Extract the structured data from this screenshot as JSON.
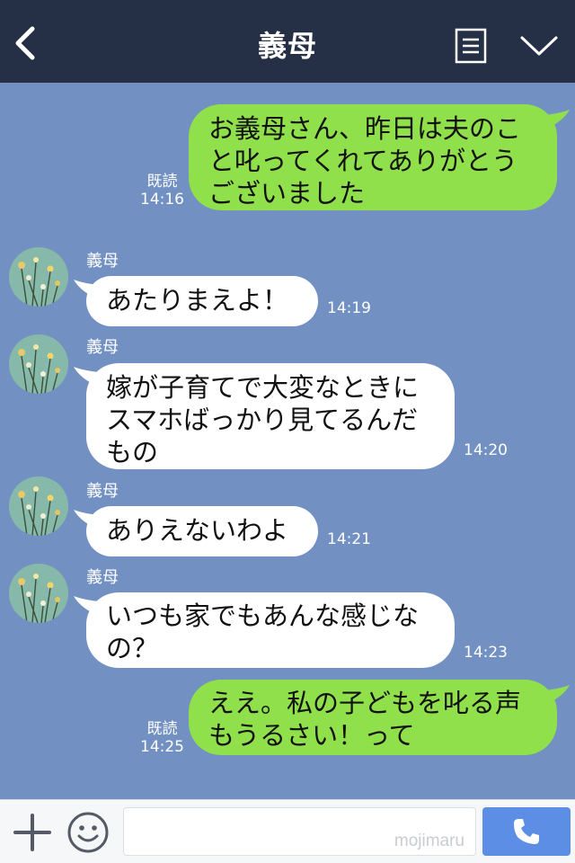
{
  "header": {
    "title": "義母"
  },
  "messages": [
    {
      "side": "me",
      "lines": [
        "お義母さん、昨日は夫のこ",
        "と叱ってくれてありがとう",
        "ございました"
      ],
      "read": "既読",
      "time": "14:16"
    },
    {
      "side": "them",
      "sender": "義母",
      "lines": [
        "あたりまえよ！"
      ],
      "time": "14:19"
    },
    {
      "side": "them",
      "sender": "義母",
      "lines": [
        "嫁が子育てで大変なときに",
        "スマホばっかり見てるんだ",
        "もの"
      ],
      "time": "14:20"
    },
    {
      "side": "them",
      "sender": "義母",
      "lines": [
        "ありえないわよ"
      ],
      "time": "14:21"
    },
    {
      "side": "them",
      "sender": "義母",
      "lines": [
        "いつも家でもあんな感じな",
        "の？"
      ],
      "time": "14:23"
    },
    {
      "side": "me",
      "lines": [
        "ええ。私の子どもを叱る声",
        "もうるさい！って"
      ],
      "read": "既読",
      "time": "14:25"
    }
  ],
  "input": {
    "value": "",
    "watermark": "mojimaru"
  },
  "colors": {
    "header_bg": "#253047",
    "chat_bg": "#7291c2",
    "my_bubble": "#8fe04b",
    "their_bubble": "#ffffff",
    "call_button": "#5c8ee6"
  },
  "icons": {
    "back": "chevron-left-icon",
    "menu": "document-list-icon",
    "collapse": "chevron-down-icon",
    "attach": "plus-icon",
    "sticker": "smiley-icon",
    "call": "phone-icon"
  }
}
